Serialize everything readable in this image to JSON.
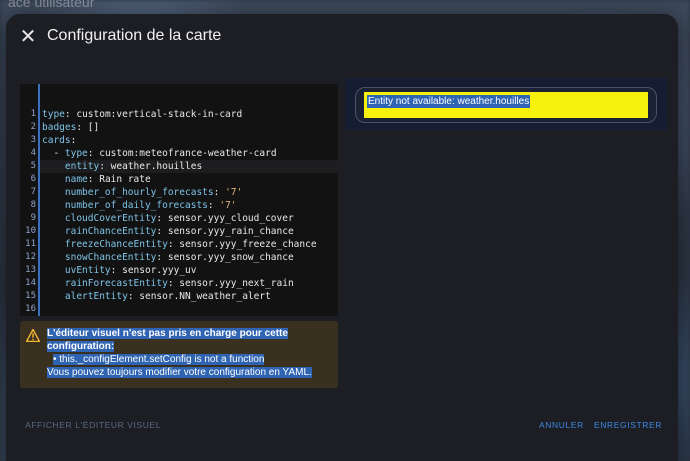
{
  "background": {
    "partial_label": "ace utilisateur"
  },
  "dialog": {
    "title": "Configuration de la carte",
    "close_icon": "close-icon"
  },
  "editor": {
    "lines": [
      {
        "n": "1",
        "indent": "",
        "key": "type",
        "value": " custom:vertical-stack-in-card",
        "type": "plain"
      },
      {
        "n": "2",
        "indent": "",
        "key": "badges",
        "value": " []",
        "type": "plain"
      },
      {
        "n": "3",
        "indent": "",
        "key": "cards",
        "value": "",
        "type": "plain"
      },
      {
        "n": "4",
        "indent": "  - ",
        "key": "type",
        "value": " custom:meteofrance-weather-card",
        "type": "plain"
      },
      {
        "n": "5",
        "indent": "    ",
        "key": "entity",
        "value": " weather.houilles",
        "type": "plain"
      },
      {
        "n": "6",
        "indent": "    ",
        "key": "name",
        "value": " Rain rate",
        "type": "plain"
      },
      {
        "n": "7",
        "indent": "    ",
        "key": "number_of_hourly_forecasts",
        "value": " '7'",
        "type": "string"
      },
      {
        "n": "8",
        "indent": "    ",
        "key": "number_of_daily_forecasts",
        "value": " '7'",
        "type": "string"
      },
      {
        "n": "9",
        "indent": "    ",
        "key": "cloudCoverEntity",
        "value": " sensor.yyy_cloud_cover",
        "type": "plain"
      },
      {
        "n": "10",
        "indent": "    ",
        "key": "rainChanceEntity",
        "value": " sensor.yyy_rain_chance",
        "type": "plain"
      },
      {
        "n": "11",
        "indent": "    ",
        "key": "freezeChanceEntity",
        "value": " sensor.yyy_freeze_chance",
        "type": "plain"
      },
      {
        "n": "12",
        "indent": "    ",
        "key": "snowChanceEntity",
        "value": " sensor.yyy_snow_chance",
        "type": "plain"
      },
      {
        "n": "13",
        "indent": "    ",
        "key": "uvEntity",
        "value": " sensor.yyy_uv",
        "type": "plain"
      },
      {
        "n": "14",
        "indent": "    ",
        "key": "rainForecastEntity",
        "value": " sensor.yyy_next_rain",
        "type": "plain"
      },
      {
        "n": "15",
        "indent": "    ",
        "key": "alertEntity",
        "value": " sensor.NN_weather_alert",
        "type": "plain"
      },
      {
        "n": "16",
        "indent": "",
        "key": "",
        "value": "",
        "type": "plain"
      }
    ],
    "colors": {
      "key": "#7ec4e8",
      "string": "#e4b47a",
      "gutter_border": "#3a6fbf"
    }
  },
  "warning": {
    "icon": "warning-triangle-icon",
    "line1": "L'éditeur visuel n'est pas pris en charge pour cette",
    "line2": "configuration:",
    "bullet": "this._configElement.setConfig is not a function",
    "line3": "Vous pouvez toujours modifier votre configuration en YAML.",
    "color": "#f5b731"
  },
  "preview": {
    "message": "Entity not available: weather.houilles",
    "highlight_color": "#f7f20b"
  },
  "footer": {
    "visual_editor_label": "Afficher l'éditeur visuel",
    "cancel_label": "Annuler",
    "save_label": "Enregistrer"
  }
}
